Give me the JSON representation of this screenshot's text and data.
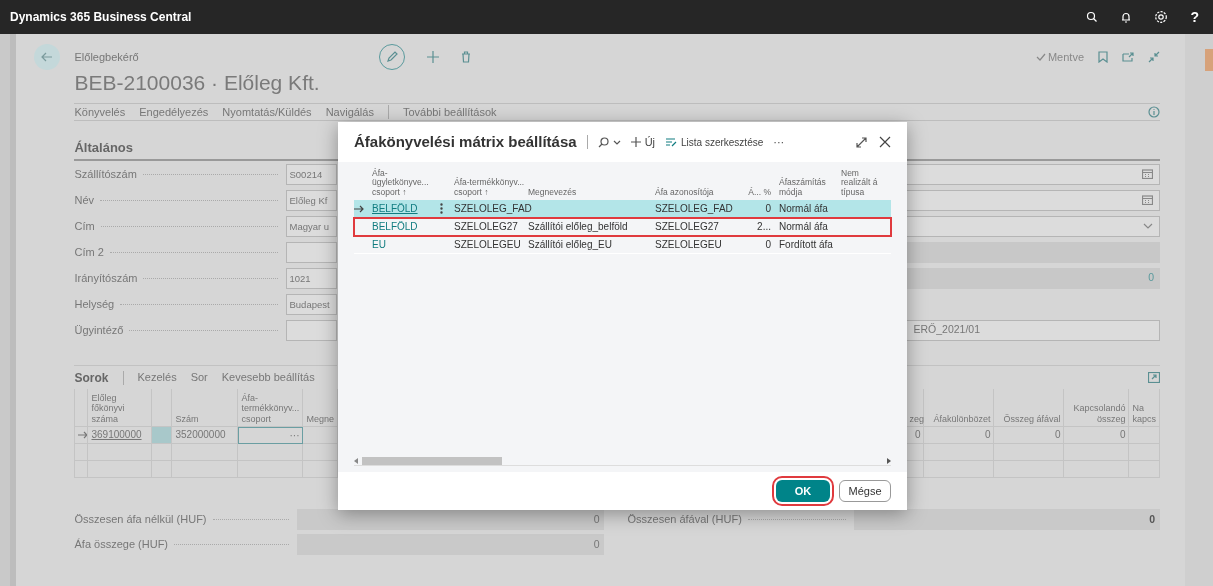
{
  "app_bar": {
    "title": "Dynamics 365 Business Central",
    "help_label": "?"
  },
  "page": {
    "breadcrumb": "Előlegbekérő",
    "title": "BEB-2100036 · Előleg Kft.",
    "saved_status": "Mentve",
    "action_tabs": [
      "Könyvelés",
      "Engedélyezés",
      "Nyomtatás/Küldés",
      "Navigálás",
      "További beállítások"
    ]
  },
  "general": {
    "heading": "Általános",
    "fields": [
      {
        "label": "Szállítószám",
        "value": "S00214",
        "right": {
          "kind": "date"
        }
      },
      {
        "label": "Név",
        "value": "Előleg Kf",
        "right": {
          "kind": "date"
        }
      },
      {
        "label": "Cím",
        "value": "Magyar u",
        "right": {
          "kind": "dropdown"
        }
      },
      {
        "label": "Cím 2",
        "right": {
          "kind": "readonly"
        }
      },
      {
        "label": "Irányítószám",
        "value": "1021",
        "right": {
          "kind": "readonly",
          "value": "0"
        }
      },
      {
        "label": "Helység",
        "value": "Budapest",
        "right": {
          "kind": "none"
        }
      },
      {
        "label": "Ügyintéző",
        "right": {
          "kind": "text",
          "value": "ERŐ_2021/01"
        }
      }
    ]
  },
  "lines": {
    "heading": "Sorok",
    "actions": [
      "Kezelés",
      "Sor",
      "Kevesebb beállítás"
    ],
    "left_columns": [
      "Előleg főkönyvi száma",
      "Szám",
      "Áfa-termékkönyv... csoport",
      "Megne"
    ],
    "right_columns": [
      "zeg",
      "Áfakülönbözet",
      "Összeg áfával",
      "Kapcsolandó összeg",
      "Na kapcs"
    ],
    "rows": [
      {
        "selected": true,
        "account": "369100000",
        "number": "352000000",
        "lookup": "···",
        "right_values": [
          "0",
          "0",
          "0",
          "0"
        ]
      }
    ]
  },
  "totals": {
    "left": [
      {
        "label": "Összesen áfa nélkül (HUF)",
        "value": "0"
      },
      {
        "label": "Áfa összege (HUF)",
        "value": "0"
      }
    ],
    "right": {
      "label": "Összesen áfával (HUF)",
      "value": "0"
    }
  },
  "dialog": {
    "title": "Áfakönyvelési mátrix beállítása",
    "new_label": "Új",
    "edit_list_label": "Lista szerkesztése",
    "more_label": "···",
    "columns": [
      "Áfa-ügyletkönyve... csoport ↑",
      "Áfa-termékkönyv... csoport ↑",
      "Megnevezés",
      "Áfa azonosítója",
      "Á... %",
      "Áfaszámítás módja",
      "Nem realizált á típusa"
    ],
    "rows": [
      {
        "selected": true,
        "annotated": false,
        "business_group": "BELFÖLD",
        "product_group": "SZELOLEG_FAD",
        "vat_id": "SZELOLEG_FAD",
        "percent": "0",
        "calculation": "Normál áfa"
      },
      {
        "selected": false,
        "annotated": true,
        "business_group": "BELFÖLD",
        "product_group": "SZELOLEG27",
        "description": "Szállítói előleg_belföld",
        "vat_id": "SZELOLEG27",
        "percent": "2...",
        "calculation": "Normál áfa"
      },
      {
        "selected": false,
        "annotated": false,
        "business_group": "EU",
        "product_group": "SZELOLEGEU",
        "description": "Szállítói előleg_EU",
        "vat_id": "SZELOLEGEU",
        "percent": "0",
        "calculation": "Fordított áfa"
      }
    ],
    "buttons": [
      {
        "label": "OK",
        "kind": "primary",
        "annotated": true
      },
      {
        "label": "Mégse",
        "kind": "secondary",
        "annotated": false
      }
    ]
  }
}
